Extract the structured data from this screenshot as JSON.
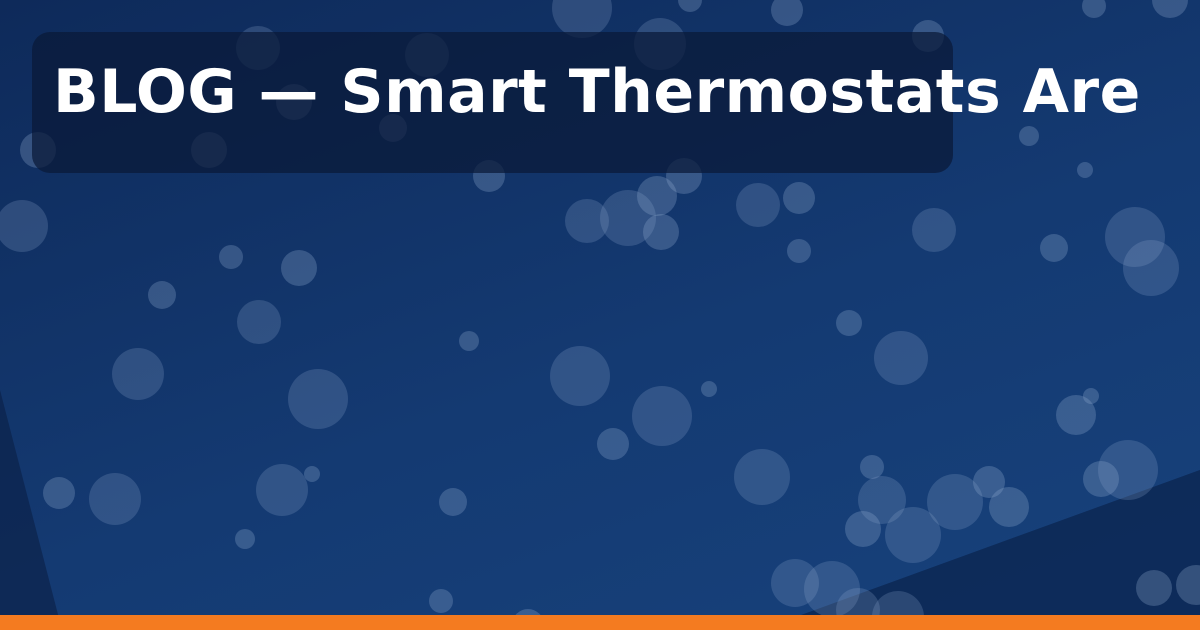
{
  "post": {
    "category": "BLOG",
    "separator": "—",
    "title": "BLOG — Smart Thermostats Are"
  },
  "colors": {
    "background_top": "#0e2a5a",
    "background_bottom": "#17427c",
    "panel": "#0a1937",
    "title_text": "#ffffff",
    "bokeh": "#8fa8cc",
    "accent_bar": "#f47b20"
  },
  "decoration": {
    "pattern": "bokeh-circles"
  }
}
